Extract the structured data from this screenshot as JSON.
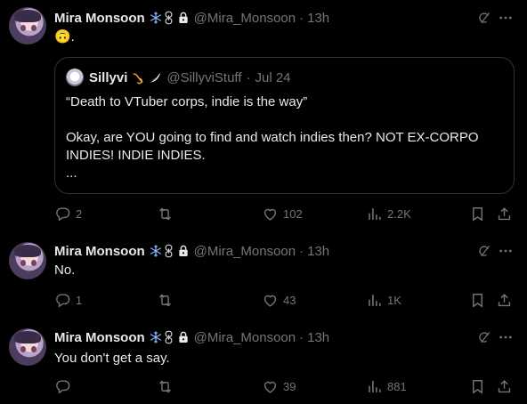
{
  "tweets": [
    {
      "author_name": "Mira Monsoon",
      "handle": "@Mira_Monsoon",
      "separator": "·",
      "time": "13h",
      "text": "🙃.",
      "quote": {
        "author_name": "Sillyvi",
        "handle": "@SillyviStuff",
        "separator": "·",
        "date": "Jul 24",
        "lines": [
          "“Death to VTuber corps, indie is the way”",
          "",
          "Okay, are YOU going to find and watch indies then? NOT EX-CORPO",
          "INDIES! INDIE INDIES.",
          "..."
        ]
      },
      "replies": "2",
      "reposts": "",
      "likes": "102",
      "views": "2.2K"
    },
    {
      "author_name": "Mira Monsoon",
      "handle": "@Mira_Monsoon",
      "separator": "·",
      "time": "13h",
      "text": "No.",
      "replies": "1",
      "reposts": "",
      "likes": "43",
      "views": "1K"
    },
    {
      "author_name": "Mira Monsoon",
      "handle": "@Mira_Monsoon",
      "separator": "·",
      "time": "13h",
      "text": "You don't get a say.",
      "replies": "",
      "reposts": "",
      "likes": "39",
      "views": "881"
    }
  ],
  "icons": {
    "badge_snowflake": "snowflake-icon",
    "badge_chain": "chain-icon",
    "badge_lock": "lock-icon",
    "quote_badge_horn": "horn-icon",
    "quote_badge_wing": "wing-icon",
    "grok": "grok-icon",
    "more": "more-icon",
    "reply": "reply-icon",
    "repost": "repost-icon",
    "like": "like-icon",
    "views": "views-icon",
    "bookmark": "bookmark-icon",
    "share": "share-icon"
  },
  "colors": {
    "background": "#000000",
    "text": "#e7e9ea",
    "muted": "#71767b",
    "border": "#2f3336",
    "snowflake": "#8fb8ff",
    "horn": "#e8a43c"
  }
}
